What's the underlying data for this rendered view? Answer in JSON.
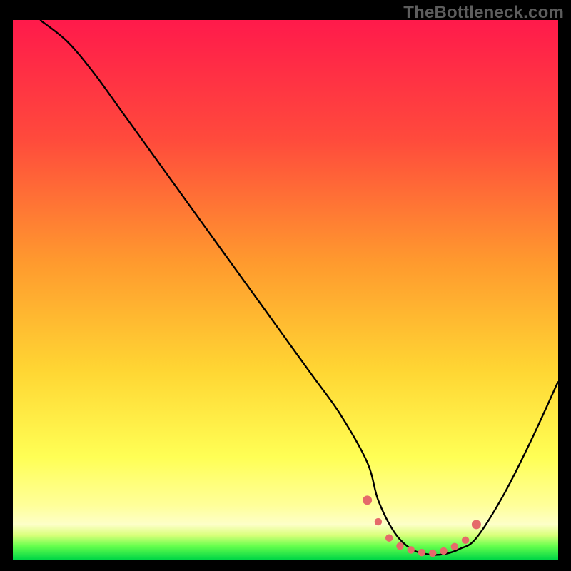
{
  "watermark": "TheBottleneck.com",
  "colors": {
    "frame": "#000000",
    "curve": "#000000",
    "marker": "#e56a6a",
    "grad_top": "#ff1a4b",
    "grad_mid1": "#ff7a33",
    "grad_mid2": "#ffd633",
    "grad_yellow": "#ffff66",
    "grad_lightyellow": "#ffffb0",
    "grad_green": "#00e04a"
  },
  "chart_data": {
    "type": "line",
    "title": "",
    "xlabel": "",
    "ylabel": "",
    "xlim": [
      0,
      100
    ],
    "ylim": [
      0,
      100
    ],
    "x": [
      5,
      10,
      15,
      20,
      25,
      30,
      35,
      40,
      45,
      50,
      55,
      60,
      65,
      67,
      70,
      73,
      76,
      79,
      82,
      85,
      90,
      95,
      100
    ],
    "values": [
      100,
      96,
      90,
      83,
      76,
      69,
      62,
      55,
      48,
      41,
      34,
      27,
      18,
      11,
      5,
      2,
      1,
      1,
      2,
      4,
      12,
      22,
      33
    ],
    "marker_points": [
      {
        "x": 65,
        "y": 11
      },
      {
        "x": 67,
        "y": 7
      },
      {
        "x": 69,
        "y": 4
      },
      {
        "x": 71,
        "y": 2.5
      },
      {
        "x": 73,
        "y": 1.8
      },
      {
        "x": 75,
        "y": 1.3
      },
      {
        "x": 77,
        "y": 1.2
      },
      {
        "x": 79,
        "y": 1.6
      },
      {
        "x": 81,
        "y": 2.4
      },
      {
        "x": 83,
        "y": 3.6
      },
      {
        "x": 85,
        "y": 6.5
      }
    ],
    "gradient_stops": [
      {
        "offset": 0.0,
        "color": "#ff1a4b"
      },
      {
        "offset": 0.22,
        "color": "#ff4a3c"
      },
      {
        "offset": 0.45,
        "color": "#ff9a2e"
      },
      {
        "offset": 0.65,
        "color": "#ffd633"
      },
      {
        "offset": 0.81,
        "color": "#ffff55"
      },
      {
        "offset": 0.9,
        "color": "#ffff9a"
      },
      {
        "offset": 0.935,
        "color": "#fdffc8"
      },
      {
        "offset": 0.955,
        "color": "#d9ff7a"
      },
      {
        "offset": 0.975,
        "color": "#66ff4d"
      },
      {
        "offset": 1.0,
        "color": "#00d646"
      }
    ]
  }
}
